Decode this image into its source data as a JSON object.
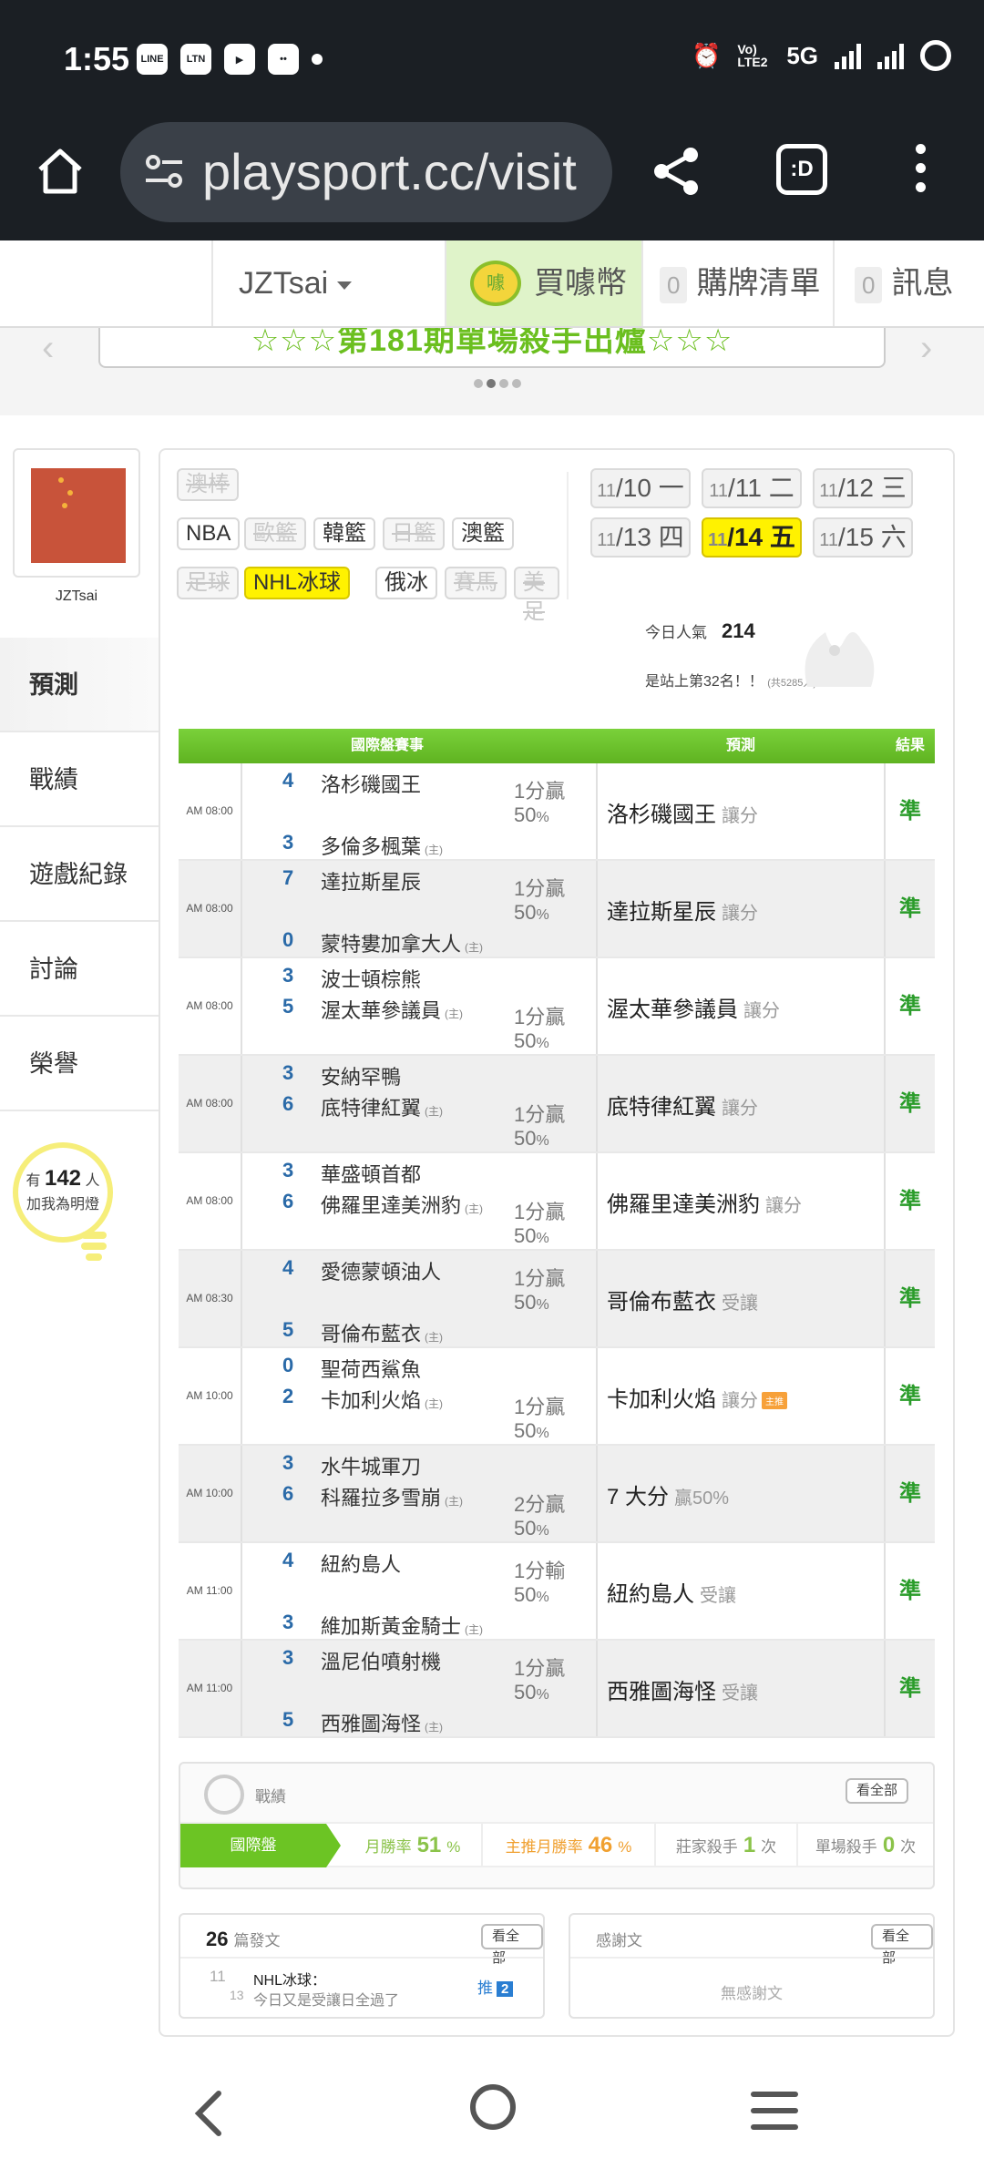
{
  "status": {
    "time": "1:55",
    "network": "5G",
    "volte": "Vo) LTE2"
  },
  "browser": {
    "url": "playsport.cc/visit"
  },
  "header": {
    "username": "JZTsai",
    "coin_label": "買噱幣",
    "coin_icon_text": "噱",
    "cart_count": "0",
    "cart_label": "購牌清單",
    "msg_count": "0",
    "msg_label": "訊息"
  },
  "banner": {
    "text": "☆☆☆第181期單場殺手出爐☆☆☆"
  },
  "profile": {
    "name": "JZTsai"
  },
  "sidebar": {
    "items": [
      {
        "label": "預測"
      },
      {
        "label": "戰績"
      },
      {
        "label": "遊戲紀錄"
      },
      {
        "label": "討論"
      },
      {
        "label": "榮譽"
      }
    ]
  },
  "light": {
    "prefix": "有",
    "count": "142",
    "unit": "人",
    "line2": "加我為明燈"
  },
  "sports": [
    {
      "label": "澳棒",
      "state": "off"
    },
    {
      "label": "NBA",
      "state": "on"
    },
    {
      "label": "歐籃",
      "state": "off"
    },
    {
      "label": "韓籃",
      "state": "on"
    },
    {
      "label": "日籃",
      "state": "off"
    },
    {
      "label": "澳籃",
      "state": "on"
    },
    {
      "label": "足球",
      "state": "off"
    },
    {
      "label": "NHL冰球",
      "state": "sel"
    },
    {
      "label": "俄冰",
      "state": "on"
    },
    {
      "label": "賽馬",
      "state": "off"
    },
    {
      "label": "美足",
      "state": "off"
    }
  ],
  "dates": [
    {
      "month": "11",
      "day": "10",
      "wd": "一"
    },
    {
      "month": "11",
      "day": "11",
      "wd": "二"
    },
    {
      "month": "11",
      "day": "12",
      "wd": "三"
    },
    {
      "month": "11",
      "day": "13",
      "wd": "四"
    },
    {
      "month": "11",
      "day": "14",
      "wd": "五"
    },
    {
      "month": "11",
      "day": "15",
      "wd": "六"
    }
  ],
  "popularity": {
    "label": "今日人氣",
    "value": "214",
    "rank_text": "是站上第32名！！",
    "rank_total": "(共5285人)"
  },
  "table": {
    "headers": [
      "國際盤賽事",
      "預測",
      "結果"
    ],
    "rows": [
      {
        "time": "AM 08:00",
        "s1": "4",
        "t1": "洛杉磯國王",
        "s2": "3",
        "t2": "多倫多楓葉",
        "home": "(主)",
        "odds1": "1分贏",
        "odds2": "50",
        "pick": "洛杉磯國王",
        "pick_type": "讓分",
        "result": "準"
      },
      {
        "time": "AM 08:00",
        "s1": "7",
        "t1": "達拉斯星辰",
        "s2": "0",
        "t2": "蒙特婁加拿大人",
        "home": "(主)",
        "odds1": "1分贏",
        "odds2": "50",
        "pick": "達拉斯星辰",
        "pick_type": "讓分",
        "result": "準"
      },
      {
        "time": "AM 08:00",
        "s1": "3",
        "t1": "波士頓棕熊",
        "s2": "5",
        "t2": "渥太華參議員",
        "home": "(主)",
        "odds1": "1分贏",
        "odds2": "50",
        "pick": "渥太華參議員",
        "pick_type": "讓分",
        "result": "準"
      },
      {
        "time": "AM 08:00",
        "s1": "3",
        "t1": "安納罕鴨",
        "s2": "6",
        "t2": "底特律紅翼",
        "home": "(主)",
        "odds1": "1分贏",
        "odds2": "50",
        "pick": "底特律紅翼",
        "pick_type": "讓分",
        "result": "準"
      },
      {
        "time": "AM 08:00",
        "s1": "3",
        "t1": "華盛頓首都",
        "s2": "6",
        "t2": "佛羅里達美洲豹",
        "home": "(主)",
        "odds1": "1分贏",
        "odds2": "50",
        "pick": "佛羅里達美洲豹",
        "pick_type": "讓分",
        "result": "準"
      },
      {
        "time": "AM 08:30",
        "s1": "4",
        "t1": "愛德蒙頓油人",
        "s2": "5",
        "t2": "哥倫布藍衣",
        "home": "(主)",
        "odds1": "1分贏",
        "odds2": "50",
        "pick": "哥倫布藍衣",
        "pick_type": "受讓",
        "result": "準"
      },
      {
        "time": "AM 10:00",
        "s1": "0",
        "t1": "聖荷西鯊魚",
        "s2": "2",
        "t2": "卡加利火焰",
        "home": "(主)",
        "odds1": "1分贏",
        "odds2": "50",
        "pick": "卡加利火焰",
        "pick_type": "讓分",
        "tag": "主推",
        "result": "準"
      },
      {
        "time": "AM 10:00",
        "s1": "3",
        "t1": "水牛城軍刀",
        "s2": "6",
        "t2": "科羅拉多雪崩",
        "home": "(主)",
        "odds1": "2分贏",
        "odds2": "50",
        "pick": "7 大分",
        "pick_type": "贏50%",
        "result": "準"
      },
      {
        "time": "AM 11:00",
        "s1": "4",
        "t1": "紐約島人",
        "s2": "3",
        "t2": "維加斯黃金騎士",
        "home": "(主)",
        "odds1": "1分輸",
        "odds2": "50",
        "pick": "紐約島人",
        "pick_type": "受讓",
        "result": "準"
      },
      {
        "time": "AM 11:00",
        "s1": "3",
        "t1": "溫尼伯噴射機",
        "s2": "5",
        "t2": "西雅圖海怪",
        "home": "(主)",
        "odds1": "1分贏",
        "odds2": "50",
        "pick": "西雅圖海怪",
        "pick_type": "受讓",
        "result": "準"
      }
    ]
  },
  "stats": {
    "title": "戰績",
    "view_all": "看全部",
    "tab": "國際盤",
    "monthly_label": "月勝率",
    "monthly_value": "51",
    "main_label": "主推月勝率",
    "main_value": "46",
    "pct": "%",
    "banker_label": "莊家殺手",
    "banker_value": "1",
    "single_label": "單場殺手",
    "single_value": "0",
    "times": "次"
  },
  "posts": {
    "count": "26",
    "label": "篇發文",
    "view_all": "看全部",
    "month": "11",
    "day": "13",
    "sport": "NHL冰球：",
    "text": "今日又是受讓日全過了",
    "push_label": "推",
    "push_count": "2"
  },
  "thanks": {
    "label": "感謝文",
    "view_all": "看全部",
    "empty": "無感謝文"
  },
  "colors": {
    "accent_green": "#6cc424",
    "select_yellow": "#fff200",
    "result_green": "#2a9c2a"
  }
}
